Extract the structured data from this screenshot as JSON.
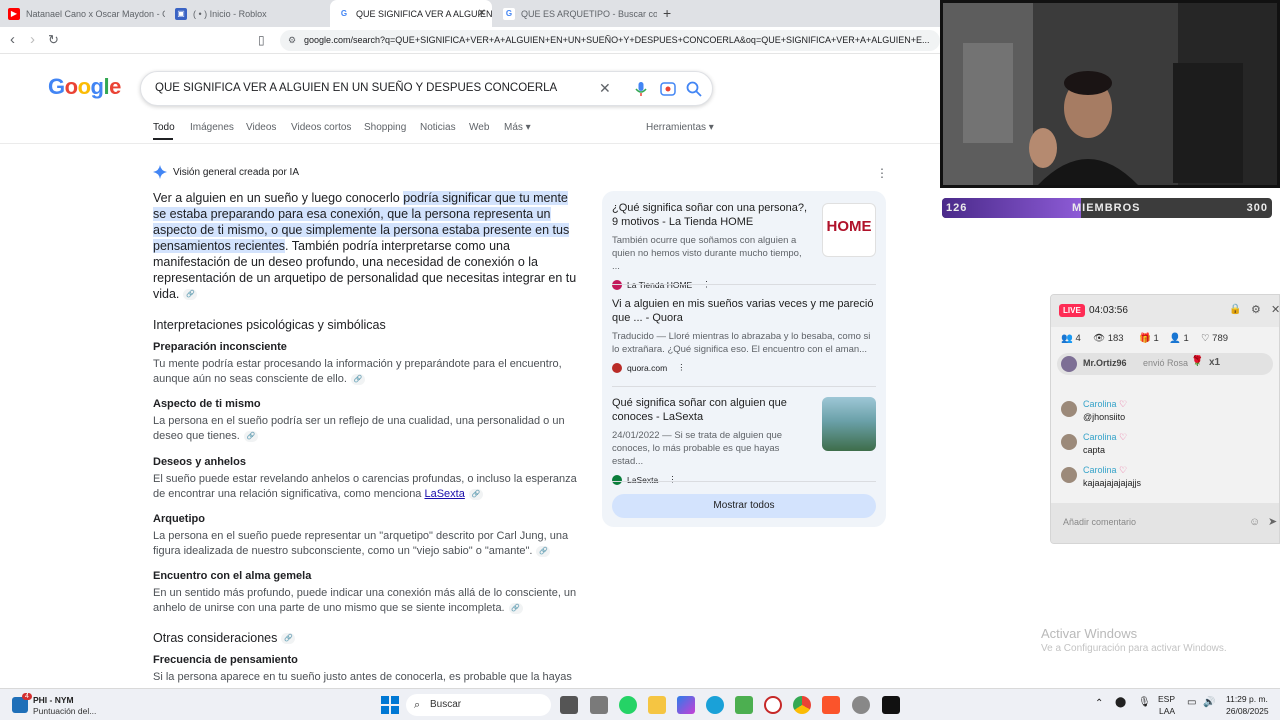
{
  "browser": {
    "tabs": [
      {
        "title": "Natanael Cano x Oscar Maydon - Gu",
        "favicon": "youtube-icon",
        "active": false
      },
      {
        "title": "( • ) Inicio - Roblox",
        "favicon": "roblox-icon",
        "active": false
      },
      {
        "title": "QUE SIGNIFICA VER A ALGUIEN",
        "favicon": "google-icon",
        "active": true
      },
      {
        "title": "QUE ES ARQUETIPO - Buscar con Go",
        "favicon": "google-icon",
        "active": false
      }
    ],
    "url": "google.com/search?q=QUE+SIGNIFICA+VER+A+ALGUIEN+EN+UN+SUEÑO+Y+DESPUES+CONCOERLA&oq=QUE+SIGNIFICA+VER+A+ALGUIEN+E..."
  },
  "search": {
    "logo": "Google",
    "query": "QUE SIGNIFICA VER A ALGUIEN EN UN SUEÑO Y DESPUES CONCOERLA",
    "tabs": [
      "Todo",
      "Imágenes",
      "Videos",
      "Videos cortos",
      "Shopping",
      "Noticias",
      "Web",
      "Más"
    ],
    "tools": "Herramientas"
  },
  "ai": {
    "header": "Visión general creada por IA",
    "para_a": "Ver a alguien en un sueño y luego conocerlo ",
    "para_hl": "podría significar que tu mente se estaba preparando para esa conexión, que la persona representa un aspecto de ti mismo, o que simplemente la persona estaba presente en tus pensamientos recientes",
    "para_b": ". También podría interpretarse como una manifestación de un deseo profundo, una necesidad de conexión o la representación de un arquetipo de personalidad que necesitas integrar en tu vida.",
    "section1": "Interpretaciones psicológicas y simbólicas",
    "items": [
      {
        "title": "Preparación inconsciente",
        "body": "Tu mente podría estar procesando la información y preparándote para el encuentro, aunque aún no seas consciente de ello."
      },
      {
        "title": "Aspecto de ti mismo",
        "body": "La persona en el sueño podría ser un reflejo de una cualidad, una personalidad o un deseo que tienes."
      },
      {
        "title": "Deseos y anhelos",
        "body": "El sueño puede estar revelando anhelos o carencias profundas, o incluso la esperanza de encontrar una relación significativa, como menciona ",
        "link": "LaSexta"
      },
      {
        "title": "Arquetipo",
        "body": "La persona en el sueño puede representar un \"arquetipo\" descrito por Carl Jung, una figura idealizada de nuestro subconsciente, como un \"viejo sabio\" o \"amante\"."
      },
      {
        "title": "Encuentro con el alma gemela",
        "body": "En un sentido más profundo, puede indicar una conexión más allá de lo consciente, un anhelo de unirse con una parte de uno mismo que se siente incompleta."
      }
    ],
    "section2": "Otras consideraciones",
    "item6_title": "Frecuencia de pensamiento",
    "item6_body": "Si la persona aparece en tu sueño justo antes de conocerla, es probable que la hayas"
  },
  "sources": [
    {
      "title": "¿Qué significa soñar con una persona?, 9 motivos - La Tienda HOME",
      "desc": "También ocurre que soñamos con alguien a quien no hemos visto durante mucho tiempo, ...",
      "site": "La Tienda HOME",
      "thumb_text": "HOME"
    },
    {
      "title": "Vi a alguien en mis sueños varias veces y me pareció que ... - Quora",
      "desc": "Traducido — Lloré mientras lo abrazaba y lo besaba, como si lo extrañara. ¿Qué significa eso. El encuentro con el aman...",
      "site": "quora.com"
    },
    {
      "title": "Qué significa soñar con alguien que conoces - LaSexta",
      "desc": "24/01/2022 — Si se trata de alguien que conoces, lo más probable es que hayas estad...",
      "site": "LaSexta"
    }
  ],
  "show_all": "Mostrar todos",
  "stream": {
    "members_left": "126",
    "members_label": "MIEMBROS",
    "members_right": "300",
    "members_fraction": 0.42
  },
  "live": {
    "badge": "LIVE",
    "time": "04:03:56",
    "stats": [
      "4",
      "183",
      "1",
      "1",
      "789"
    ],
    "gift_user": "Mr.Ortiz96",
    "gift_text": "envió Rosa",
    "gift_count": "x1",
    "messages": [
      {
        "user": "Carolina",
        "text": "@jhonsiito"
      },
      {
        "user": "Carolina",
        "text": "capta"
      },
      {
        "user": "Carolina",
        "text": "kajaajajajajajjs"
      }
    ],
    "comment_placeholder": "Añadir comentario"
  },
  "watermark": {
    "line1": "Activar Windows",
    "line2": "Ve a Configuración para activar Windows."
  },
  "taskbar": {
    "weather_title": "PHI - NYM",
    "weather_sub": "Puntuación del...",
    "weather_badge": "4",
    "search": "Buscar",
    "lang1": "ESP",
    "lang2": "LAA",
    "time": "11:29 p. m.",
    "date": "26/08/2025"
  }
}
